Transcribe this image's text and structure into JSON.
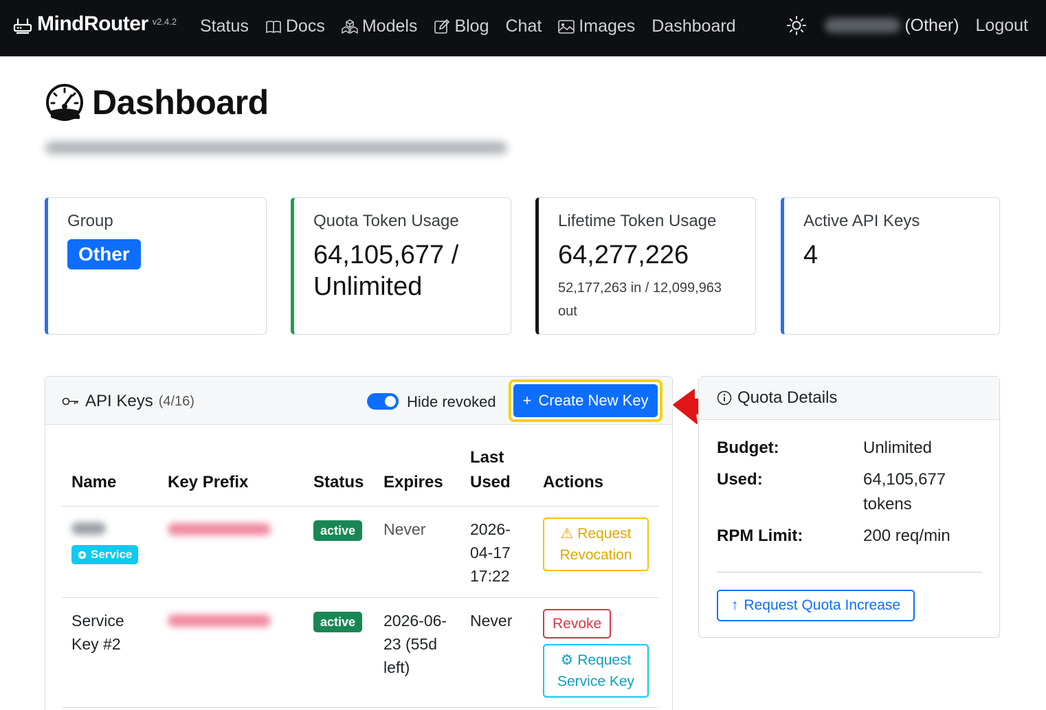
{
  "nav": {
    "brand": "MindRouter",
    "version": "v2.4.2",
    "links": {
      "status": "Status",
      "docs": "Docs",
      "models": "Models",
      "blog": "Blog",
      "chat": "Chat",
      "images": "Images",
      "dashboard": "Dashboard"
    },
    "user_group": "(Other)",
    "logout": "Logout"
  },
  "page": {
    "title": "Dashboard"
  },
  "stats": {
    "group": {
      "label": "Group",
      "value": "Other"
    },
    "quota": {
      "label": "Quota Token Usage",
      "value_line1": "64,105,677 /",
      "value_line2": "Unlimited"
    },
    "lifetime": {
      "label": "Lifetime Token Usage",
      "value": "64,277,226",
      "detail": "52,177,263 in / 12,099,963 out"
    },
    "active_keys": {
      "label": "Active API Keys",
      "value": "4"
    }
  },
  "api_keys": {
    "title": "API Keys",
    "count": "(4/16)",
    "hide_revoked_label": "Hide revoked",
    "hide_revoked": true,
    "create_button": "Create New Key",
    "columns": {
      "name": "Name",
      "key_prefix": "Key Prefix",
      "status": "Status",
      "expires": "Expires",
      "last_used": "Last Used",
      "actions": "Actions"
    },
    "rows": [
      {
        "service_badge": "Service",
        "status": "active",
        "expires": "Never",
        "last_used": "2026-04-17 17:22",
        "action": "Request Revocation"
      },
      {
        "name": "Service Key #2",
        "status": "active",
        "expires": "2026-06-23 (55d left)",
        "last_used": "Never",
        "action_primary": "Revoke",
        "action_secondary": "Request Service Key"
      }
    ]
  },
  "quota_details": {
    "title": "Quota Details",
    "budget_label": "Budget:",
    "budget_value": "Unlimited",
    "used_label": "Used:",
    "used_value": "64,105,677 tokens",
    "rpm_label": "RPM Limit:",
    "rpm_value": "200 req/min",
    "request_button": "Request Quota Increase"
  },
  "colors": {
    "navbar_bg": "#0d0f12",
    "primary": "#0d6efd",
    "success": "#198754",
    "warning": "#ffc107",
    "danger": "#dc3545",
    "info": "#0dcaf0",
    "highlight": "#f2d30f",
    "arrow": "#e01515"
  }
}
